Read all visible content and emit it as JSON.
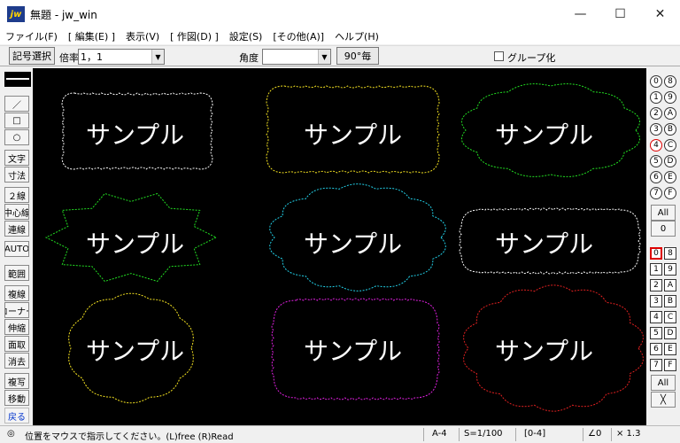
{
  "window": {
    "icon_text": "jw",
    "title": "無題 - jw_win",
    "minimize": "—",
    "maximize": "☐",
    "close": "✕"
  },
  "menu": [
    "ファイル(F)",
    "[ 編集(E) ]",
    "表示(V)",
    "[ 作図(D) ]",
    "設定(S)",
    "[その他(A)]",
    "ヘルプ(H)"
  ],
  "toolbar": {
    "symbol_select": "記号選択",
    "scale_label": "倍率",
    "scale_value": "1，1",
    "angle_label": "角度",
    "angle_value": "",
    "rotate_90": "90°毎",
    "group_label": "グループ化"
  },
  "left_tools": [
    "／",
    "□",
    "○",
    "文字",
    "寸法",
    "２線",
    "中心線",
    "連線",
    "AUTO",
    "範囲",
    "複線",
    "コーナー",
    "伸縮",
    "面取",
    "消去",
    "複写",
    "移動",
    "戻る"
  ],
  "canvas": {
    "label": "サンプル"
  },
  "layers": [
    "0",
    "8",
    "1",
    "9",
    "2",
    "A",
    "3",
    "B",
    "4",
    "C",
    "5",
    "D",
    "6",
    "E",
    "7",
    "F"
  ],
  "layer_all": "All",
  "layer_zero": "0",
  "groups": [
    "0",
    "8",
    "1",
    "9",
    "2",
    "A",
    "3",
    "B",
    "4",
    "C",
    "5",
    "D",
    "6",
    "E",
    "7",
    "F"
  ],
  "group_all": "All",
  "group_cross": "╳",
  "status": {
    "icon": "◎",
    "message": "位置をマウスで指示してください。(L)free (R)Read",
    "paper": "A-4",
    "scale": "S=1/100",
    "layer": "[0-4]",
    "angle": "∠0",
    "zoom": "× 1.3"
  },
  "colors": {
    "white": "#ffffff",
    "yellow": "#f2e020",
    "green": "#22dd22",
    "cyan": "#22d0e8",
    "magenta": "#e020e0",
    "red": "#e02020"
  }
}
